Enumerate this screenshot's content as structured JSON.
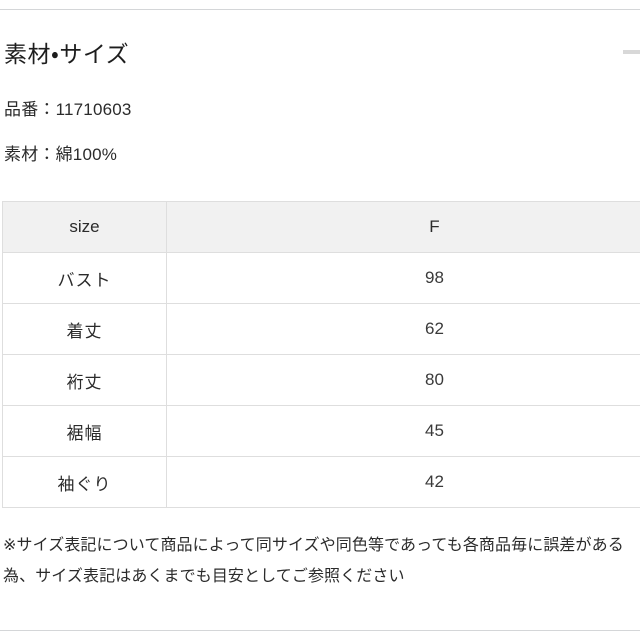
{
  "section": {
    "title": "素材・サイズ",
    "collapse_icon": "minus-icon"
  },
  "meta": {
    "product_number_line": "品番：11710603",
    "material_line": "素材：綿100%"
  },
  "size_table": {
    "columns": [
      "size",
      "F"
    ],
    "rows": [
      {
        "label": "バスト",
        "value": "98"
      },
      {
        "label": "着丈",
        "value": "62"
      },
      {
        "label": "裄丈",
        "value": "80"
      },
      {
        "label": "裾幅",
        "value": "45"
      },
      {
        "label": "袖ぐり",
        "value": "42"
      }
    ]
  },
  "footnote": {
    "text": "※サイズ表記について商品によって同サイズや同色等であっても各商品毎に誤差がある為、サイズ表記はあくまでも目安としてご参照ください"
  },
  "colors": {
    "header_row_bg": "#f1f1f1",
    "table_border": "#dedede",
    "rule": "#d4d6d8",
    "text": "#2b2b2b",
    "toggle": "#d8d8d8"
  }
}
